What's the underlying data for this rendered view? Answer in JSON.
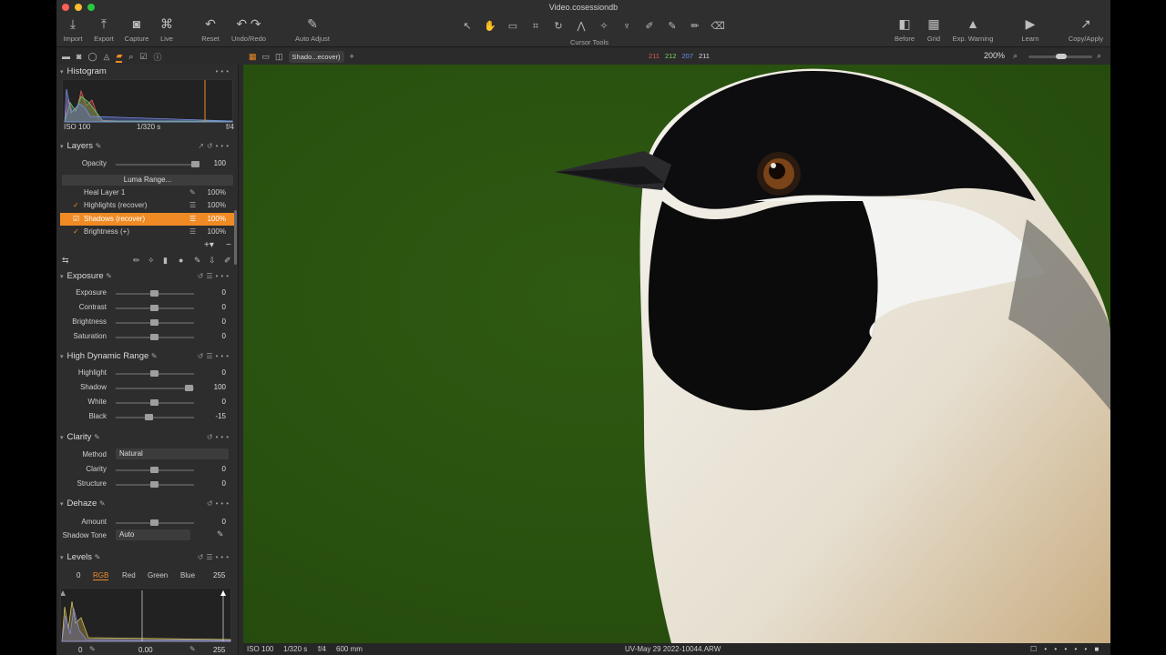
{
  "window": {
    "title": "Video.cosessiondb"
  },
  "toolbar": {
    "import": "Import",
    "export": "Export",
    "capture": "Capture",
    "live": "Live",
    "reset": "Reset",
    "undo_redo": "Undo/Redo",
    "auto_adjust": "Auto Adjust",
    "cursor_tools": "Cursor Tools",
    "before": "Before",
    "grid": "Grid",
    "exp_warning": "Exp. Warning",
    "learn": "Learn",
    "copy_apply": "Copy/Apply"
  },
  "viewer_bar": {
    "variant": "Shado...ecover)",
    "rgb": {
      "r": "211",
      "g": "212",
      "b": "207",
      "l": "211"
    },
    "zoom": "200%"
  },
  "histogram": {
    "title": "Histogram",
    "iso": "ISO 100",
    "shutter": "1/320 s",
    "aperture": "f/4"
  },
  "layers": {
    "title": "Layers",
    "opacity_label": "Opacity",
    "opacity_value": "100",
    "luma_range": "Luma Range...",
    "items": [
      {
        "name": "Heal Layer 1",
        "check": "",
        "pct": "100%"
      },
      {
        "name": "Highlights (recover)",
        "check": "✓",
        "pct": "100%"
      },
      {
        "name": "Shadows (recover)",
        "check": "☑",
        "pct": "100%"
      },
      {
        "name": "Brightness (+)",
        "check": "✓",
        "pct": "100%"
      }
    ]
  },
  "exposure": {
    "title": "Exposure",
    "rows": [
      {
        "label": "Exposure",
        "value": "0"
      },
      {
        "label": "Contrast",
        "value": "0"
      },
      {
        "label": "Brightness",
        "value": "0"
      },
      {
        "label": "Saturation",
        "value": "0"
      }
    ]
  },
  "hdr": {
    "title": "High Dynamic Range",
    "rows": [
      {
        "label": "Highlight",
        "value": "0"
      },
      {
        "label": "Shadow",
        "value": "100"
      },
      {
        "label": "White",
        "value": "0"
      },
      {
        "label": "Black",
        "value": "-15"
      }
    ]
  },
  "clarity": {
    "title": "Clarity",
    "method_label": "Method",
    "method_value": "Natural",
    "rows": [
      {
        "label": "Clarity",
        "value": "0"
      },
      {
        "label": "Structure",
        "value": "0"
      }
    ]
  },
  "dehaze": {
    "title": "Dehaze",
    "amount_label": "Amount",
    "amount_value": "0",
    "shadow_tone_label": "Shadow Tone",
    "shadow_tone_value": "Auto"
  },
  "levels": {
    "title": "Levels",
    "low": "0",
    "high": "255",
    "tabs": [
      "RGB",
      "Red",
      "Green",
      "Blue"
    ],
    "bottom_low": "0",
    "bottom_mid": "0.00",
    "bottom_high": "255"
  },
  "status": {
    "iso": "ISO 100",
    "shutter": "1/320 s",
    "aperture": "f/4",
    "focal": "600 mm",
    "filename": "UV-May 29 2022-10044.ARW"
  },
  "colors": {
    "accent": "#f08a24",
    "background": "#2a5310"
  }
}
